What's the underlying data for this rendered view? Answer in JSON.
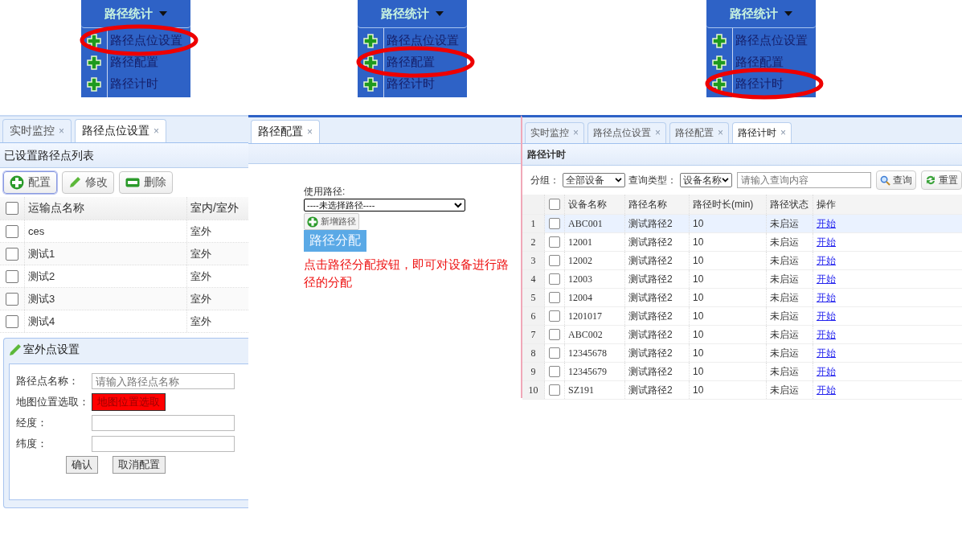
{
  "menus": [
    {
      "title": "路径统计",
      "items": [
        {
          "label": "路径点位设置",
          "highlighted": true
        },
        {
          "label": "路径配置",
          "highlighted": false
        },
        {
          "label": "路径计时",
          "highlighted": false
        }
      ]
    },
    {
      "title": "路径统计",
      "items": [
        {
          "label": "路径点位设置",
          "highlighted": false
        },
        {
          "label": "路径配置",
          "highlighted": true
        },
        {
          "label": "路径计时",
          "highlighted": false
        }
      ]
    },
    {
      "title": "路径统计",
      "items": [
        {
          "label": "路径点位设置",
          "highlighted": false
        },
        {
          "label": "路径配置",
          "highlighted": false
        },
        {
          "label": "路径计时",
          "highlighted": true
        }
      ]
    }
  ],
  "point_panel": {
    "tabs": [
      {
        "label": "实时监控",
        "close": "×",
        "selected": false
      },
      {
        "label": "路径点位设置",
        "close": "×",
        "selected": true
      }
    ],
    "title": "已设置路径点列表",
    "toolbar": [
      {
        "label": "配置"
      },
      {
        "label": "修改"
      },
      {
        "label": "删除"
      }
    ],
    "table": {
      "header_checked": false,
      "columns": [
        "运输点名称",
        "室内/室外"
      ],
      "rows": [
        {
          "name": "ces",
          "location": "室外",
          "checked": false
        },
        {
          "name": "测试1",
          "location": "室外",
          "checked": false
        },
        {
          "name": "测试2",
          "location": "室外",
          "checked": false
        },
        {
          "name": "测试3",
          "location": "室外",
          "checked": false
        },
        {
          "name": "测试4",
          "location": "室外",
          "checked": false
        }
      ]
    },
    "form": {
      "title": "室外点设置",
      "fields": [
        {
          "kind": "input",
          "label": "路径点名称：",
          "placeholder": "请输入路径点名称"
        },
        {
          "kind": "button",
          "label": "地图位置选取：",
          "button": "地图位置选取"
        },
        {
          "kind": "input",
          "label": "经度："
        },
        {
          "kind": "input",
          "label": "纬度："
        }
      ],
      "buttons": [
        "确认",
        "取消配置"
      ]
    }
  },
  "route_panel": {
    "tabs": [
      {
        "label": "路径配置",
        "close": "×",
        "selected": true
      }
    ],
    "field_label": "使用路径:",
    "select_value": "----未选择路径----",
    "add_button": "新增路径",
    "assign_button": "路径分配",
    "note": "点击路径分配按钮，即可对设备进行路径的分配"
  },
  "timing_panel": {
    "tabs": [
      {
        "label": "实时监控",
        "close": "×",
        "selected": false
      },
      {
        "label": "路径点位设置",
        "close": "×",
        "selected": false
      },
      {
        "label": "路径配置",
        "close": "×",
        "selected": false
      },
      {
        "label": "路径计时",
        "close": "×",
        "selected": true
      }
    ],
    "title": "路径计时",
    "filters": {
      "group_label": "分组：",
      "group_value": "全部设备",
      "type_label": "查询类型：",
      "type_value": "设备名称",
      "placeholder": "请输入查询内容",
      "search_button": "查询",
      "reset_button": "重置"
    },
    "table": {
      "header_checked": false,
      "columns": [
        "设备名称",
        "路径名称",
        "路径时长(min)",
        "路径状态",
        "操作"
      ],
      "rows": [
        {
          "index": "1",
          "device": "ABC001",
          "route": "测试路径2",
          "duration": "10",
          "status": "未启运",
          "action": "开始",
          "checked": false,
          "selected": true
        },
        {
          "index": "2",
          "device": "12001",
          "route": "测试路径2",
          "duration": "10",
          "status": "未启运",
          "action": "开始",
          "checked": false,
          "selected": false
        },
        {
          "index": "3",
          "device": "12002",
          "route": "测试路径2",
          "duration": "10",
          "status": "未启运",
          "action": "开始",
          "checked": false,
          "selected": false
        },
        {
          "index": "4",
          "device": "12003",
          "route": "测试路径2",
          "duration": "10",
          "status": "未启运",
          "action": "开始",
          "checked": false,
          "selected": false
        },
        {
          "index": "5",
          "device": "12004",
          "route": "测试路径2",
          "duration": "10",
          "status": "未启运",
          "action": "开始",
          "checked": false,
          "selected": false
        },
        {
          "index": "6",
          "device": "1201017",
          "route": "测试路径2",
          "duration": "10",
          "status": "未启运",
          "action": "开始",
          "checked": false,
          "selected": false
        },
        {
          "index": "7",
          "device": "ABC002",
          "route": "测试路径2",
          "duration": "10",
          "status": "未启运",
          "action": "开始",
          "checked": false,
          "selected": false
        },
        {
          "index": "8",
          "device": "12345678",
          "route": "测试路径2",
          "duration": "10",
          "status": "未启运",
          "action": "开始",
          "checked": false,
          "selected": false
        },
        {
          "index": "9",
          "device": "12345679",
          "route": "测试路径2",
          "duration": "10",
          "status": "未启运",
          "action": "开始",
          "checked": false,
          "selected": false
        },
        {
          "index": "10",
          "device": "SZ191",
          "route": "测试路径2",
          "duration": "10",
          "status": "未启运",
          "action": "开始",
          "checked": false,
          "selected": false
        }
      ]
    }
  }
}
